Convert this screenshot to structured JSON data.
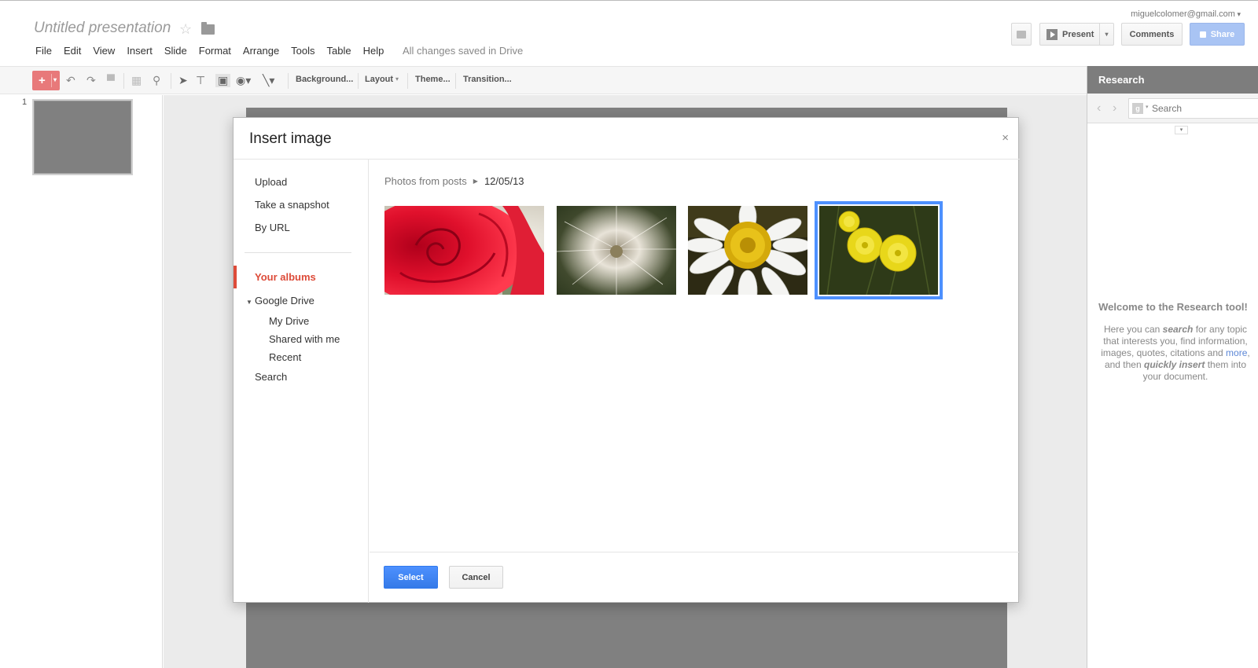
{
  "header": {
    "doc_title": "Untitled presentation",
    "save_status": "All changes saved in Drive",
    "user_email": "miguelcolomer@gmail.com",
    "present_label": "Present",
    "comments_label": "Comments",
    "share_label": "Share"
  },
  "menu": [
    "File",
    "Edit",
    "View",
    "Insert",
    "Slide",
    "Format",
    "Arrange",
    "Tools",
    "Table",
    "Help"
  ],
  "toolbar": {
    "new_slide": "+",
    "background": "Background...",
    "layout": "Layout",
    "theme": "Theme...",
    "transition": "Transition..."
  },
  "slides": {
    "current_number": "1"
  },
  "research": {
    "title": "Research",
    "search_placeholder": "Search",
    "welcome_title": "Welcome to the Research tool!",
    "welcome_pre": "Here you can ",
    "welcome_search": "search",
    "welcome_mid": " for any topic that interests you, find information, images, quotes, citations and ",
    "welcome_more": "more",
    "welcome_mid2": ", and then ",
    "welcome_quick": "quickly insert",
    "welcome_post": " them into your document."
  },
  "dialog": {
    "title": "Insert image",
    "close": "×",
    "sources": {
      "upload": "Upload",
      "snapshot": "Take a snapshot",
      "by_url": "By URL",
      "your_albums": "Your albums",
      "google_drive": "Google Drive",
      "my_drive": "My Drive",
      "shared": "Shared with me",
      "recent": "Recent",
      "search": "Search"
    },
    "breadcrumb": {
      "root": "Photos from posts",
      "current": "12/05/13"
    },
    "photos": [
      "red-rose",
      "dandelion-seed-head",
      "white-daisy",
      "yellow-dandelions"
    ],
    "selected_photo": "yellow-dandelions",
    "select_label": "Select",
    "cancel_label": "Cancel"
  },
  "colors": {
    "accent_blue": "#4d90fe",
    "albums_red": "#dd4b39",
    "share_blue": "#a9c4f4",
    "new_slide_red": "#e8797a"
  }
}
